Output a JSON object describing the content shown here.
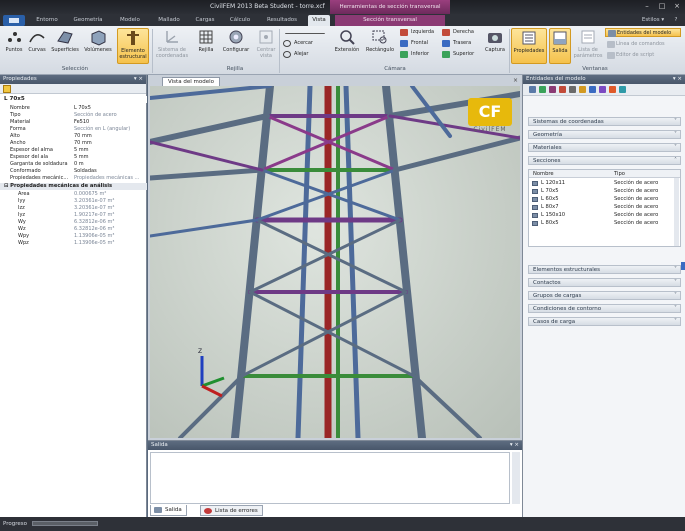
{
  "titlebar": {
    "title": "CivilFEM 2013 Beta Student - torre.xcf",
    "context": "Herramientas de sección transversal"
  },
  "tabs": [
    {
      "label": "",
      "kind": "file"
    },
    {
      "label": "Entorno"
    },
    {
      "label": "Geometría"
    },
    {
      "label": "Modelo"
    },
    {
      "label": "Mallado"
    },
    {
      "label": "Cargas"
    },
    {
      "label": "Cálculo"
    },
    {
      "label": "Resultados"
    },
    {
      "label": "Vista",
      "active": true
    },
    {
      "label": "Sección transversal",
      "kind": "ctx"
    }
  ],
  "help": {
    "label": "Estilos"
  },
  "ribbon": {
    "seleccion": {
      "label": "Selección",
      "buttons": [
        "Puntos",
        "Curvas",
        "Superficies",
        "Volúmenes",
        "Elemento estructural"
      ]
    },
    "rejilla": {
      "label": "Rejilla",
      "buttons": [
        "Sistema de coordenadas",
        "Rejilla",
        "Configurar",
        "Centrar vista"
      ]
    },
    "camara": {
      "label": "Cámara",
      "zoom": [
        "Acercar",
        "Alejar"
      ],
      "buttons": [
        "Extensión",
        "Rectángulo"
      ],
      "views": [
        "Izquierda",
        "Frontal",
        "Inferior",
        "Derecha",
        "Trasera",
        "Superior"
      ],
      "capture": "Captura"
    },
    "ventanas": {
      "label": "Ventanas",
      "buttons": [
        "Propiedades",
        "Salida",
        "Lista de parámetros"
      ],
      "list": [
        "Entidades del modelo",
        "Línea de comandos",
        "Editor de script"
      ]
    }
  },
  "properties": {
    "header": "Propiedades",
    "object": "L 70x5",
    "rows": [
      {
        "k": "Nombre",
        "v": "L 70x5"
      },
      {
        "k": "Tipo",
        "v": "Sección de acero",
        "grey": true
      },
      {
        "k": "Material",
        "v": "Fe510"
      },
      {
        "k": "Forma",
        "v": "Sección en L (angular)",
        "grey": true
      },
      {
        "k": "Alto",
        "v": "70 mm"
      },
      {
        "k": "Ancho",
        "v": "70 mm"
      },
      {
        "k": "Espesor del alma",
        "v": "5 mm"
      },
      {
        "k": "Espesor del ala",
        "v": "5 mm"
      },
      {
        "k": "Garganta de soldadura",
        "v": "0 m"
      },
      {
        "k": "Conformado",
        "v": "Soldadas"
      },
      {
        "k": "Propiedades mecánic...",
        "v": "Propiedades mecánicas ...",
        "grey": true
      }
    ],
    "mech_section": "Propiedades mecánicas de análisis",
    "mech": [
      {
        "k": "Area",
        "v": "0.000675 m²"
      },
      {
        "k": "Iyy",
        "v": "3.20361e-07 m⁴"
      },
      {
        "k": "Izz",
        "v": "3.20361e-07 m⁴"
      },
      {
        "k": "Iyz",
        "v": "1.90217e-07 m⁴"
      },
      {
        "k": "Wy",
        "v": "6.32812e-06 m³"
      },
      {
        "k": "Wz",
        "v": "6.32812e-06 m³"
      },
      {
        "k": "Wpy",
        "v": "1.13906e-05 m³"
      },
      {
        "k": "Wpz",
        "v": "1.13906e-05 m³"
      }
    ]
  },
  "viewport": {
    "tab": "Vista del modelo",
    "logo_letters": "CF",
    "logo_name": "CivilFEM",
    "axis": {
      "z": "Z"
    }
  },
  "output": {
    "header": "Salida",
    "tabs": [
      "Salida",
      "Lista de errores"
    ]
  },
  "entities": {
    "header": "Entidades del modelo",
    "sections": [
      "Sistemas de coordenadas",
      "Geometría",
      "Materiales",
      "Secciones",
      "Elementos estructurales",
      "Contactos",
      "Grupos de cargas",
      "Condiciones de contorno",
      "Casos de carga"
    ],
    "table": {
      "col_name": "Nombre",
      "col_type": "Tipo",
      "rows": [
        {
          "n": "L 120x11",
          "t": "Sección de acero"
        },
        {
          "n": "L 70x5",
          "t": "Sección de acero"
        },
        {
          "n": "L 60x5",
          "t": "Sección de acero"
        },
        {
          "n": "L 80x7",
          "t": "Sección de acero"
        },
        {
          "n": "L 150x10",
          "t": "Sección de acero"
        },
        {
          "n": "L 80x5",
          "t": "Sección de acero"
        }
      ]
    }
  },
  "status": {
    "label": "Progreso"
  },
  "colors": {
    "accent": "#f5c24d",
    "ctx": "#8b3a74",
    "panel_header": "#4f5e72"
  }
}
